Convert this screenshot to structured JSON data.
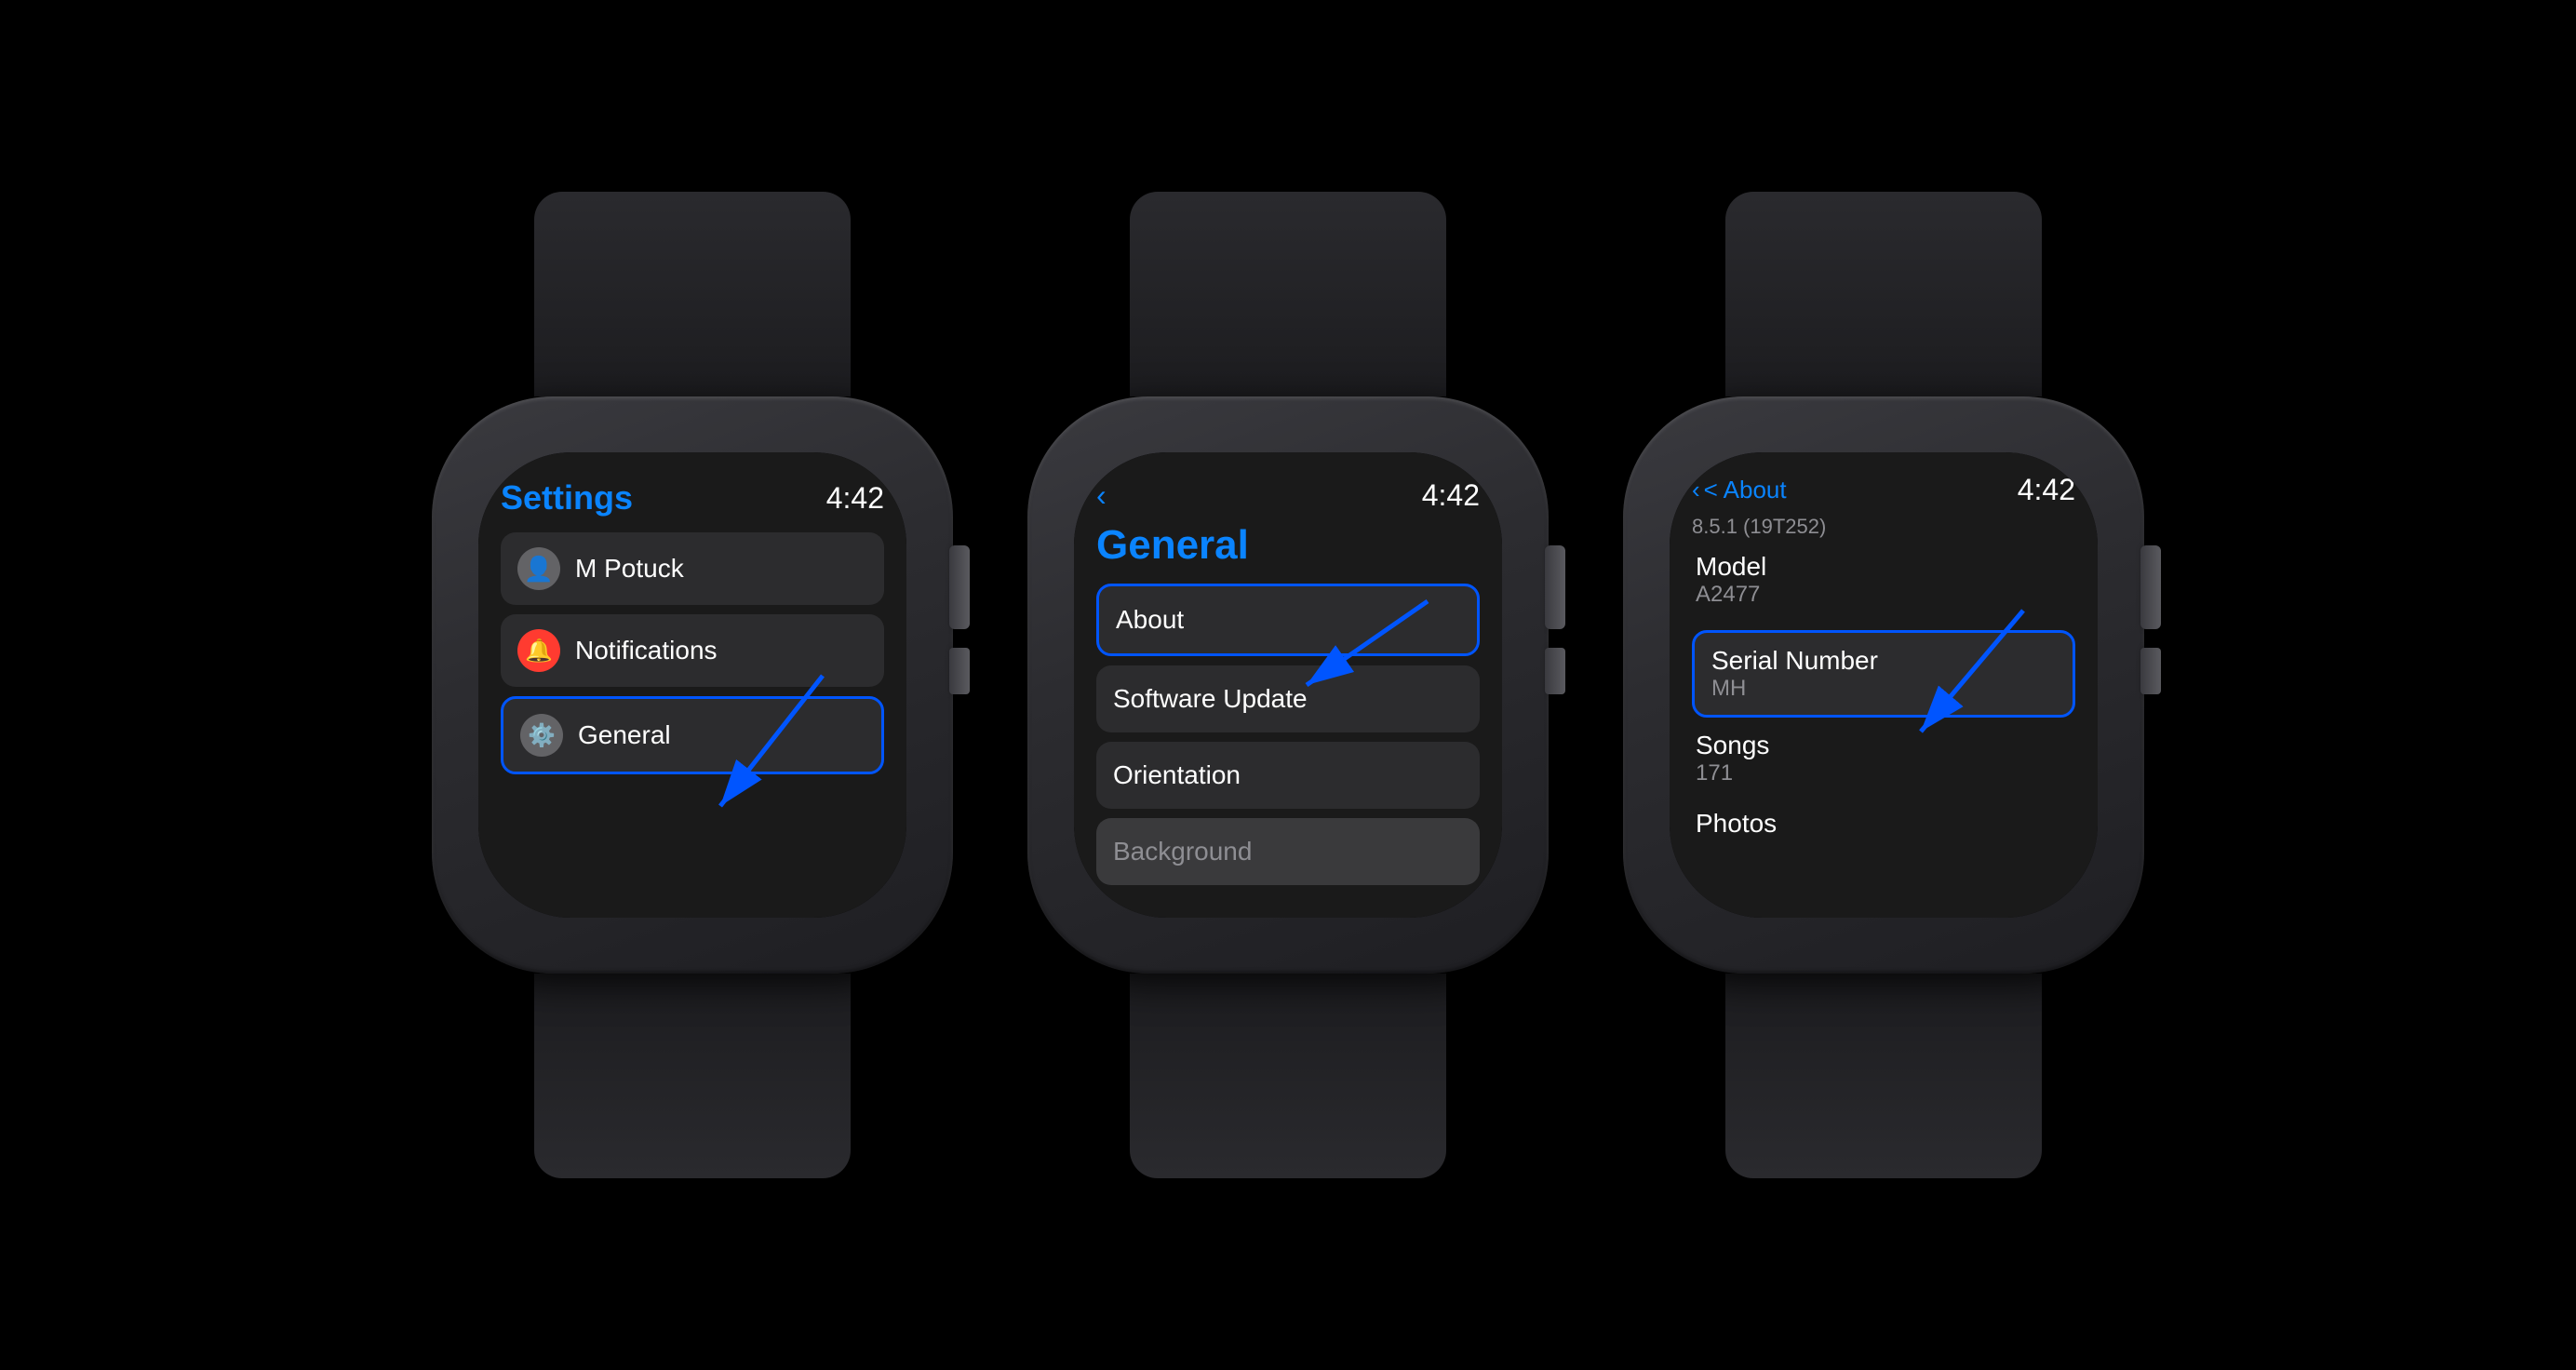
{
  "colors": {
    "blue": "#0a84ff",
    "arrowBlue": "#0055ff",
    "bg": "#1a1a1a",
    "itemBg": "#2c2c2e",
    "textPrimary": "#ffffff",
    "textSecondary": "#8e8e93"
  },
  "watch1": {
    "title": "Settings",
    "time": "4:42",
    "items": [
      {
        "icon": "👤",
        "iconBg": "avatar",
        "label": "M Potuck",
        "highlighted": false
      },
      {
        "icon": "🔔",
        "iconBg": "red",
        "label": "Notifications",
        "highlighted": false
      },
      {
        "icon": "⚙️",
        "iconBg": "gray",
        "label": "General",
        "highlighted": true
      }
    ]
  },
  "watch2": {
    "back": "<",
    "title": "General",
    "time": "4:42",
    "items": [
      {
        "label": "About",
        "highlighted": true
      },
      {
        "label": "Software Update",
        "highlighted": false
      },
      {
        "label": "Orientation",
        "highlighted": false
      },
      {
        "label": "Background",
        "highlighted": false
      }
    ]
  },
  "watch3": {
    "back": "< About",
    "time": "4:42",
    "version": "8.5.1 (19T252)",
    "rows": [
      {
        "label": "Model",
        "value": "A2477",
        "highlighted": false
      },
      {
        "label": "Serial Number",
        "value": "MH",
        "highlighted": true
      },
      {
        "label": "Songs",
        "value": "171",
        "highlighted": false
      },
      {
        "label": "Photos",
        "value": "",
        "highlighted": false
      }
    ]
  }
}
